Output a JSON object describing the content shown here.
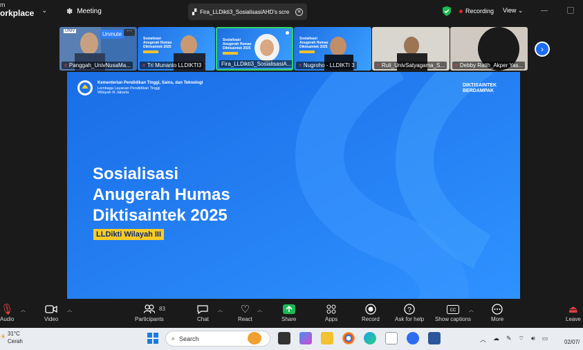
{
  "app": {
    "brand_line1": "m",
    "brand_line2": "orkplace",
    "meeting_label": "Meeting",
    "share_tab_title": "Fira_LLDikti3_SosialisasiAHD's scre",
    "recording_label": "Recording",
    "view_label": "View"
  },
  "participants": [
    {
      "name": "Panggah_UnivNusaMa...",
      "muted": true,
      "unmute_label": "Unmute"
    },
    {
      "name": "Tri Munanto LLDIKTI3",
      "muted": true
    },
    {
      "name": "Fira_LLDikti3_SosialisasiA...",
      "muted": false
    },
    {
      "name": "Nugroho - LLDIKTI 3",
      "muted": true
    },
    {
      "name": "Ruli_UnivSatyagama_S...",
      "muted": true
    },
    {
      "name": "Debby Ratih_Akper Yas...",
      "muted": true
    }
  ],
  "mini_slide": {
    "line1": "Sosialisasi",
    "line2": "Anugerah Humas",
    "line3": "Diktisaintek 2025"
  },
  "slide": {
    "ministry_line1": "Kementerian Pendidikan Tinggi, Sains, dan Teknologi",
    "ministry_line2": "Lembaga Layanan Pendidikan Tinggi",
    "ministry_line3": "Wilayah III Jakarta",
    "brand_right_line1": "DIKTISAINTEK",
    "brand_right_line2": "BERDAMPAK",
    "title_line1": "Sosialisasi",
    "title_line2": "Anugerah Humas",
    "title_line3": "Diktisaintek 2025",
    "tag": "LLDikti Wilayah III"
  },
  "controls": {
    "audio": "Audio",
    "video": "Video",
    "participants": "Participants",
    "participants_count": "83",
    "chat": "Chat",
    "react": "React",
    "share": "Share",
    "apps": "Apps",
    "record": "Record",
    "ask_for_help": "Ask for help",
    "show_captions": "Show captions",
    "more": "More",
    "leave": "Leave"
  },
  "taskbar": {
    "temp": "31°C",
    "weather": "Cerah",
    "search_placeholder": "Search",
    "date": "02/07/"
  },
  "colors": {
    "accent": "#1d6cf5",
    "slide_blue": "#1c74ea",
    "tag_yellow": "#f7cb28",
    "share_green": "#1db954",
    "record_red": "#e02828"
  }
}
